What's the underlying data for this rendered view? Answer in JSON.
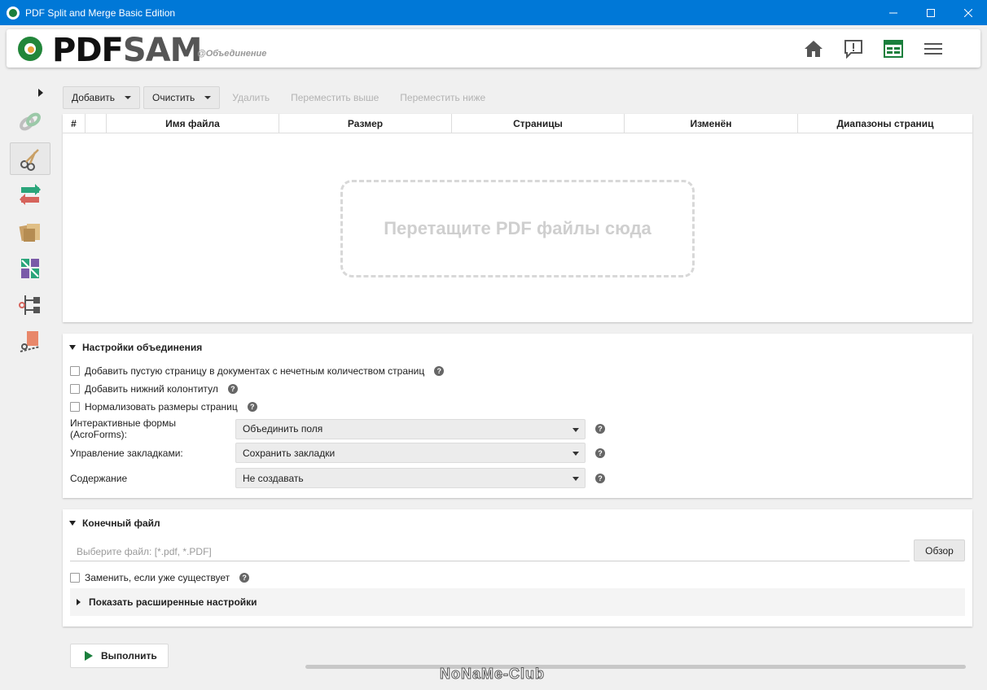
{
  "window": {
    "title": "PDF Split and Merge Basic Edition",
    "controls": [
      "minimize",
      "maximize",
      "close"
    ]
  },
  "header": {
    "logo_part1": "PDF",
    "logo_part2": "SAM",
    "module_label": "@Объединение",
    "icons": [
      "home-icon",
      "feedback-icon",
      "dashboard-icon",
      "menu-icon"
    ],
    "accent": "#1a7f3c"
  },
  "nav": {
    "items": [
      "merge",
      "split",
      "rotate",
      "alternate-mix",
      "extract",
      "split-by-bookmarks",
      "split-by-size"
    ],
    "active": "split"
  },
  "toolbar": {
    "add_label": "Добавить",
    "clear_label": "Очистить",
    "remove_label": "Удалить",
    "move_up_label": "Переместить выше",
    "move_down_label": "Переместить ниже"
  },
  "table": {
    "columns": [
      "#",
      "",
      "Имя файла",
      "Размер",
      "Страницы",
      "Изменён",
      "Диапазоны страниц"
    ],
    "drop_hint": "Перетащите PDF файлы сюда"
  },
  "merge_settings": {
    "title": "Настройки объединения",
    "blank_page": "Добавить пустую страницу в документах с нечетным количеством страниц",
    "footer": "Добавить нижний колонтитул",
    "normalize": "Нормализовать размеры страниц",
    "acroforms_label": "Интерактивные формы (AcroForms):",
    "acroforms_value": "Объединить поля",
    "bookmarks_label": "Управление закладками:",
    "bookmarks_value": "Сохранить закладки",
    "toc_label": "Содержание",
    "toc_value": "Не создавать"
  },
  "destination": {
    "title": "Конечный файл",
    "placeholder": "Выберите файл: [*.pdf, *.PDF]",
    "browse_label": "Обзор",
    "overwrite_label": "Заменить, если уже существует",
    "advanced_label": "Показать расширенные настройки"
  },
  "run": {
    "label": "Выполнить"
  },
  "watermark": "NoNaMe-Club"
}
